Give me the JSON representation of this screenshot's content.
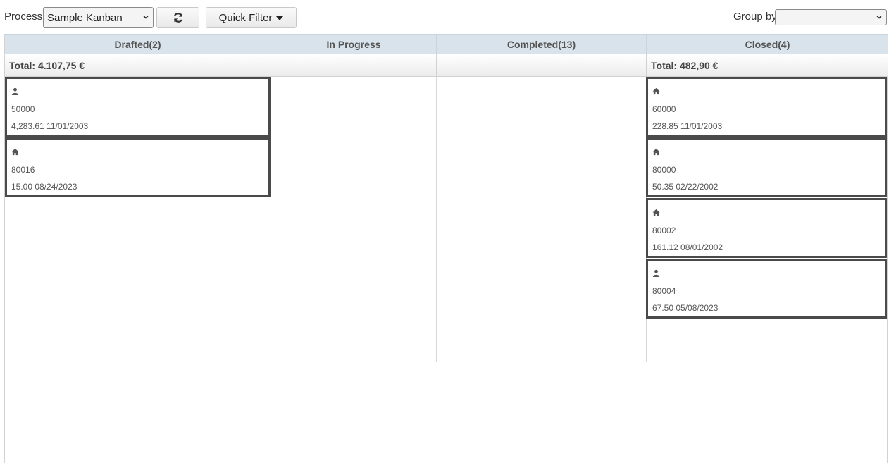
{
  "toolbar": {
    "process_label": "Process",
    "process_value": "Sample Kanban",
    "quick_filter_label": "Quick Filter",
    "group_by_label": "Group by",
    "group_by_value": ""
  },
  "columns": [
    {
      "id": "drafted",
      "title": "Drafted(2)",
      "total": "Total: 4.107,75 €",
      "cards": [
        {
          "icon": "user-icon",
          "name": "50000",
          "meta": "4,283.61 11/01/2003"
        },
        {
          "icon": "home-icon",
          "name": "80016",
          "meta": "15.00 08/24/2023"
        }
      ]
    },
    {
      "id": "in-progress",
      "title": "In Progress",
      "total": "",
      "cards": []
    },
    {
      "id": "completed",
      "title": "Completed(13)",
      "total": "",
      "cards": []
    },
    {
      "id": "closed",
      "title": "Closed(4)",
      "total": "Total: 482,90 €",
      "cards": [
        {
          "icon": "home-icon",
          "name": "60000",
          "meta": "228.85 11/01/2003"
        },
        {
          "icon": "home-icon",
          "name": "80000",
          "meta": "50.35 02/22/2002"
        },
        {
          "icon": "home-icon",
          "name": "80002",
          "meta": "161.12 08/01/2002"
        },
        {
          "icon": "user-icon",
          "name": "80004",
          "meta": "67.50 05/08/2023"
        }
      ]
    }
  ],
  "colors": {
    "header_bg": "#d8e3ec",
    "card_border": "#4a4a4a"
  }
}
